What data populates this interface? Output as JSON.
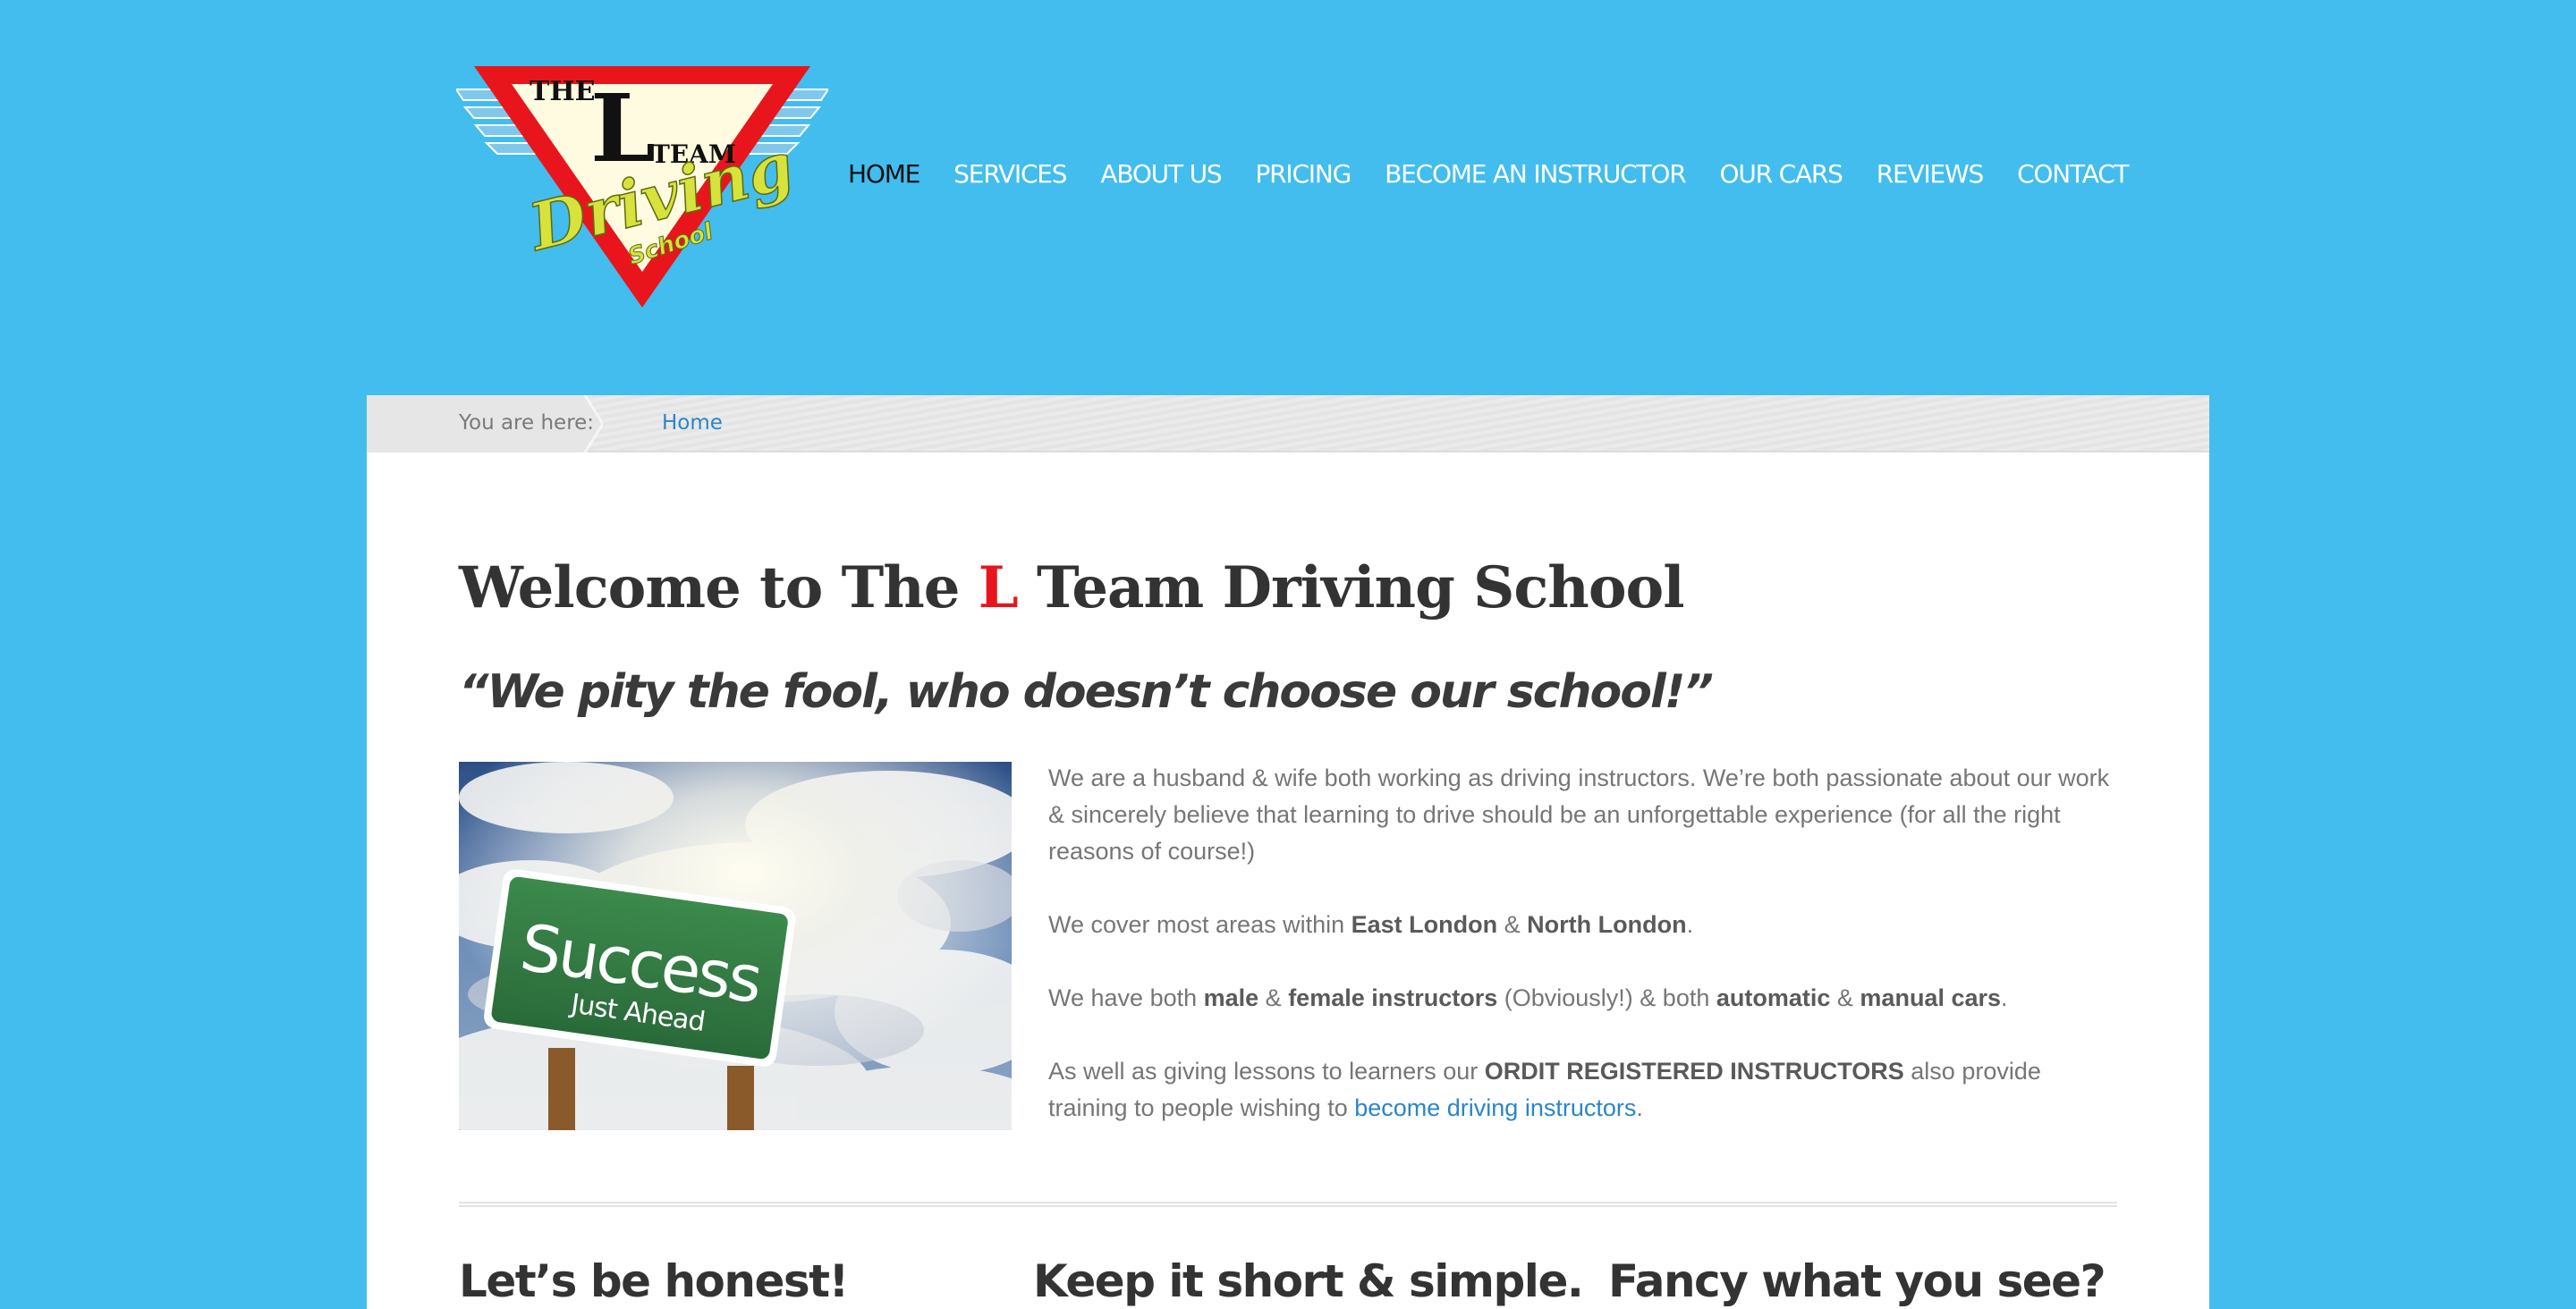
{
  "logo": {
    "text_the": "THE",
    "text_l": "L",
    "text_team": "TEAM",
    "text_driving": "Driving",
    "text_school": "School"
  },
  "nav": {
    "items": [
      {
        "label": "HOME",
        "active": true
      },
      {
        "label": "SERVICES"
      },
      {
        "label": "ABOUT US"
      },
      {
        "label": "PRICING"
      },
      {
        "label": "BECOME AN INSTRUCTOR"
      },
      {
        "label": "OUR CARS"
      },
      {
        "label": "REVIEWS"
      },
      {
        "label": "CONTACT"
      }
    ]
  },
  "breadcrumb": {
    "prefix": "You are here:",
    "current": "Home"
  },
  "page": {
    "title_before": "Welcome to The ",
    "title_highlight": "L",
    "title_after": " Team Driving School",
    "tagline": "“We pity the fool, who doesn’t choose our school!”"
  },
  "hero_image": {
    "sign_title": "Success",
    "sign_subtitle": "Just Ahead"
  },
  "intro": {
    "p1": "We are a husband & wife both working as driving instructors. We’re both passionate about our work & sincerely believe that learning to drive should be an unforgettable experience (for all the right reasons of course!)",
    "p2_a": "We cover most areas within ",
    "p2_b": "East London",
    "p2_c": " & ",
    "p2_d": "North London",
    "p2_e": ".",
    "p3_a": "We have both ",
    "p3_b": "male",
    "p3_c": " & ",
    "p3_d": "female instructors",
    "p3_e": " (Obviously!) & both ",
    "p3_f": "automatic",
    "p3_g": " & ",
    "p3_h": "manual cars",
    "p3_i": ".",
    "p4_a": "As well as giving lessons to learners our ",
    "p4_b": "ORDIT REGISTERED INSTRUCTORS",
    "p4_c": " also provide training to people wishing to ",
    "p4_link": "become driving instructors",
    "p4_d": "."
  },
  "columns": {
    "col1_heading": "Let’s be honest!",
    "col2_heading": "Keep it short & simple.",
    "col3_heading": "Fancy what you see?"
  },
  "colors": {
    "background": "#42bdee",
    "link": "#2a86c7",
    "highlight_red": "#e8161c",
    "logo_yellow": "#d8e23c"
  }
}
